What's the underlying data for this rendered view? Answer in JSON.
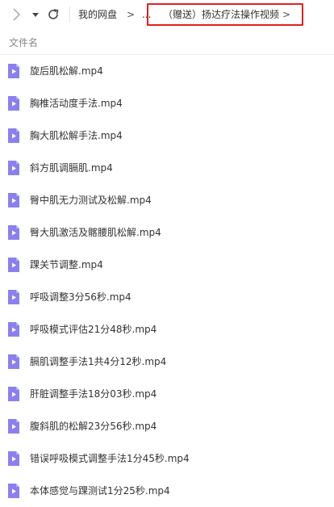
{
  "toolbar": {
    "forward_icon": "chevron-right-icon",
    "dropdown_icon": "caret-down-icon",
    "refresh_icon": "refresh-icon"
  },
  "breadcrumb": {
    "root": "我的网盘",
    "separator": ">",
    "ellipsis": "...",
    "current": "（赠送）扬达疗法操作视频",
    "highlight_color": "#e0201f"
  },
  "list": {
    "column_header": "文件名",
    "file_icon": "video-file-icon",
    "icon_color": "#8b7ff0",
    "files": [
      "旋后肌松解.mp4",
      "胸椎活动度手法.mp4",
      "胸大肌松解手法.mp4",
      "斜方肌调膈肌.mp4",
      "臀中肌无力测试及松解.mp4",
      "臀大肌激活及髂腰肌松解.mp4",
      "踝关节调整.mp4",
      "呼吸调整3分56秒.mp4",
      "呼吸模式评估21分48秒.mp4",
      "膈肌调整手法1共4分12秒.mp4",
      "肝脏调整手法18分03秒.mp4",
      "腹斜肌的松解23分56秒.mp4",
      "错误呼吸模式调整手法1分45秒.mp4",
      "本体感觉与踝测试1分25秒.mp4"
    ]
  }
}
